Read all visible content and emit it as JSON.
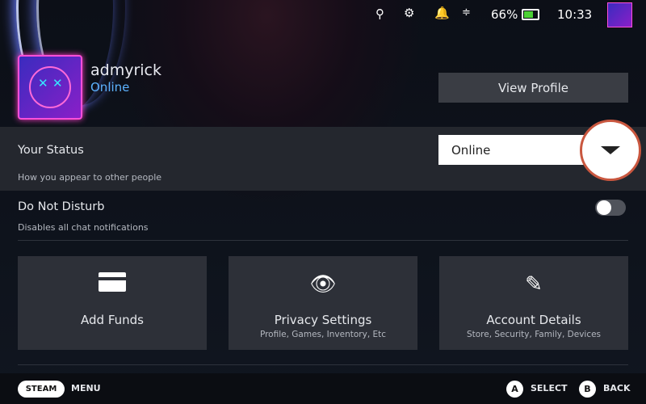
{
  "topbar": {
    "battery": "66%",
    "time": "10:33",
    "icons": [
      "search-icon",
      "settings-icon",
      "bell-icon",
      "signal-icon",
      "battery-icon"
    ]
  },
  "profile": {
    "username": "admyrick",
    "status": "Online",
    "view_profile": "View Profile"
  },
  "your_status": {
    "title": "Your Status",
    "subtitle": "How you appear to other people",
    "value": "Online"
  },
  "dnd": {
    "title": "Do Not Disturb",
    "subtitle": "Disables all chat notifications",
    "enabled": false
  },
  "cards": [
    {
      "label": "Add Funds",
      "sub": ""
    },
    {
      "label": "Privacy Settings",
      "sub": "Profile, Games, Inventory, Etc"
    },
    {
      "label": "Account Details",
      "sub": "Store, Security, Family, Devices"
    }
  ],
  "footer": {
    "steam": "STEAM",
    "menu": "MENU",
    "a": "A",
    "select": "SELECT",
    "b": "B",
    "back": "BACK"
  }
}
